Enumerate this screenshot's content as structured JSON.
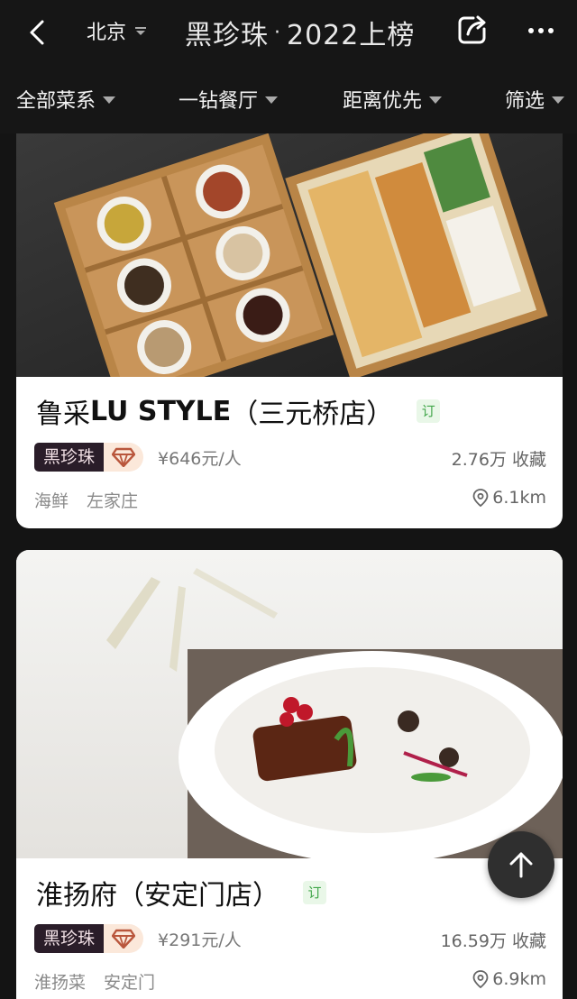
{
  "header": {
    "city": "北京",
    "brand_name": "黑珍珠",
    "brand_dot": "·",
    "brand_year": "2022上榜"
  },
  "filters": [
    "全部菜系",
    "一钻餐厅",
    "距离优先",
    "筛选"
  ],
  "restaurants": [
    {
      "name_zh": "鲁采",
      "name_en": "LU STYLE",
      "branch": "（三元桥店）",
      "book_tag": "订",
      "badge": "黑珍珠",
      "price": "¥646元/人",
      "collect": "2.76万 收藏",
      "tags": [
        "海鲜",
        "左家庄"
      ],
      "distance": "6.1km"
    },
    {
      "name_zh": "淮扬府",
      "name_en": "",
      "branch": "（安定门店）",
      "book_tag": "订",
      "badge": "黑珍珠",
      "price": "¥291元/人",
      "collect": "16.59万 收藏",
      "tags": [
        "淮扬菜",
        "安定门"
      ],
      "distance": "6.9km"
    }
  ],
  "icons": {
    "back": "chevron-left-icon",
    "city_caret": "caret-down-icon",
    "share": "share-icon",
    "more": "more-icon",
    "diamond": "diamond-icon",
    "location": "location-pin-icon",
    "top": "arrow-up-icon"
  },
  "colors": {
    "background": "#141414",
    "badge_bg": "#2a1d29",
    "book_green": "#41a64a",
    "diamond": "#b9563c"
  }
}
